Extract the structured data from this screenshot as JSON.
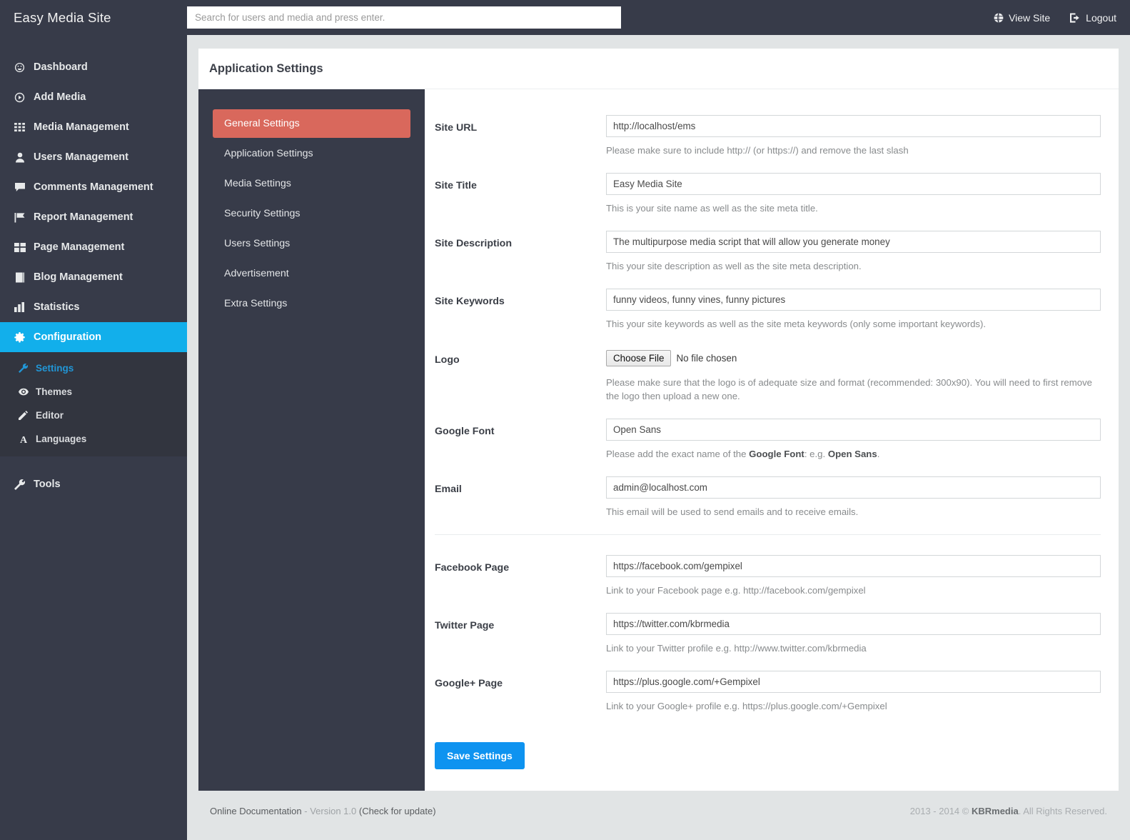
{
  "brand": {
    "name": "Easy Media Site"
  },
  "search": {
    "placeholder": "Search for users and media and press enter.",
    "value": ""
  },
  "topbar": {
    "view_site": "View Site",
    "logout": "Logout"
  },
  "sidebar": {
    "items": [
      {
        "label": "Dashboard",
        "icon": "dashboard-icon"
      },
      {
        "label": "Add Media",
        "icon": "add-media-icon"
      },
      {
        "label": "Media Management",
        "icon": "grid-icon"
      },
      {
        "label": "Users Management",
        "icon": "user-icon"
      },
      {
        "label": "Comments Management",
        "icon": "comment-icon"
      },
      {
        "label": "Report Management",
        "icon": "flag-icon"
      },
      {
        "label": "Page Management",
        "icon": "layout-icon"
      },
      {
        "label": "Blog Management",
        "icon": "book-icon"
      },
      {
        "label": "Statistics",
        "icon": "bar-chart-icon"
      },
      {
        "label": "Configuration",
        "icon": "gear-icon",
        "active": true
      }
    ],
    "submenu": [
      {
        "label": "Settings",
        "icon": "wrench-icon",
        "current": true
      },
      {
        "label": "Themes",
        "icon": "eye-icon"
      },
      {
        "label": "Editor",
        "icon": "pencil-icon"
      },
      {
        "label": "Languages",
        "icon": "font-a-icon"
      }
    ],
    "tools": {
      "label": "Tools",
      "icon": "wrench-icon"
    }
  },
  "page": {
    "title": "Application Settings"
  },
  "tabs": [
    {
      "label": "General Settings",
      "active": true
    },
    {
      "label": "Application Settings"
    },
    {
      "label": "Media Settings"
    },
    {
      "label": "Security Settings"
    },
    {
      "label": "Users Settings"
    },
    {
      "label": "Advertisement"
    },
    {
      "label": "Extra Settings"
    }
  ],
  "form": {
    "site_url": {
      "label": "Site URL",
      "value": "http://localhost/ems",
      "hint": "Please make sure to include http:// (or https://) and remove the last slash"
    },
    "site_title": {
      "label": "Site Title",
      "value": "Easy Media Site",
      "hint": "This is your site name as well as the site meta title."
    },
    "site_description": {
      "label": "Site Description",
      "value": "The multipurpose media script that will allow you generate money",
      "hint": "This your site description as well as the site meta description."
    },
    "site_keywords": {
      "label": "Site Keywords",
      "value": "funny videos, funny vines, funny pictures",
      "hint": "This your site keywords as well as the site meta keywords (only some important keywords)."
    },
    "logo": {
      "label": "Logo",
      "button": "Choose File",
      "status": "No file chosen",
      "hint": "Please make sure that the logo is of adequate size and format (recommended: 300x90). You will need to first remove the logo then upload a new one."
    },
    "google_font": {
      "label": "Google Font",
      "value": "Open Sans",
      "hint_prefix": "Please add the exact name of the ",
      "hint_bold1": "Google Font",
      "hint_mid": ": e.g. ",
      "hint_bold2": "Open Sans",
      "hint_suffix": "."
    },
    "email": {
      "label": "Email",
      "value": "admin@localhost.com",
      "hint": "This email will be used to send emails and to receive emails."
    },
    "facebook_page": {
      "label": "Facebook Page",
      "value": "https://facebook.com/gempixel",
      "hint": "Link to your Facebook page e.g. http://facebook.com/gempixel"
    },
    "twitter_page": {
      "label": "Twitter Page",
      "value": "https://twitter.com/kbrmedia",
      "hint": "Link to your Twitter profile e.g. http://www.twitter.com/kbrmedia"
    },
    "google_plus_page": {
      "label": "Google+ Page",
      "value": "https://plus.google.com/+Gempixel",
      "hint": "Link to your Google+ profile e.g. https://plus.google.com/+Gempixel"
    },
    "save_button": "Save Settings"
  },
  "footer": {
    "doc_link": "Online Documentation",
    "version": " - Version 1.0 ",
    "check_update": "(Check for update)",
    "copyright_prefix": "2013 - 2014 © ",
    "copyright_brand": "KBRmedia",
    "copyright_suffix": ". All Rights Reserved."
  },
  "colors": {
    "sidebar_bg": "#373b49",
    "accent_blue": "#12afeb",
    "active_tab_red": "#d9685c",
    "save_blue": "#0e93f0",
    "page_bg": "#e1e4e5"
  }
}
